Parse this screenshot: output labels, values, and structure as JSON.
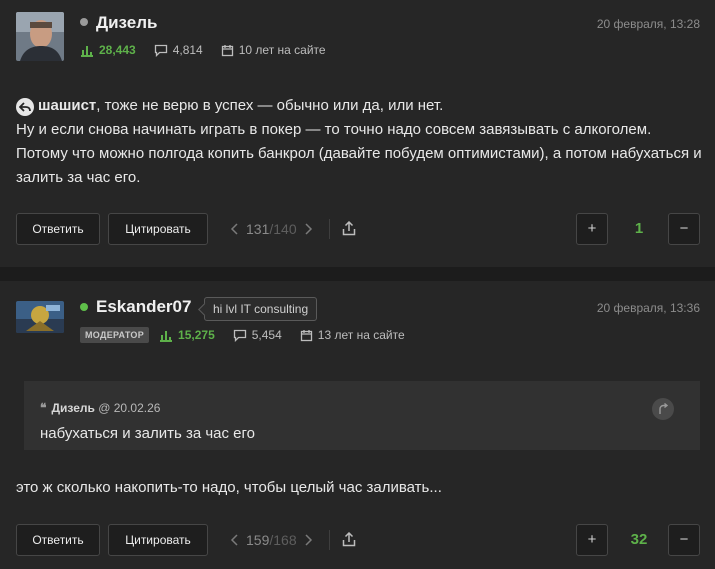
{
  "colors": {
    "rating": "#5eb14a",
    "online": "#5fbf4a",
    "offline": "#9a9a9a",
    "background": "#262626"
  },
  "posts": [
    {
      "author": "Дизель",
      "date": "20 февраля, 13:28",
      "rating": "28,443",
      "comments": "4,814",
      "tenure": "10 лет на сайте",
      "online": false,
      "reply_to": "шашист",
      "text_line1": ", тоже не верю в успех — обычно или да, или нет.",
      "text_line2": "Ну и если снова начинать играть в покер — то точно надо совсем завязывать с алкоголем. Потому что можно полгода копить банкрол (давайте побудем оптимистами), а потом набухаться и залить за час его.",
      "actions": {
        "reply": "Ответить",
        "quote": "Цитировать"
      },
      "pager": {
        "current": "131",
        "total": "140"
      },
      "votes": "1"
    },
    {
      "author": "Eskander07",
      "date": "20 февраля, 13:36",
      "status_tooltip": "hi lvl IT consulting",
      "badge": "МОДЕРАТОР",
      "rating": "15,275",
      "comments": "5,454",
      "tenure": "13 лет на сайте",
      "online": true,
      "quote": {
        "author": "Дизель",
        "date": "@ 20.02.26",
        "text": "набухаться и залить за час его"
      },
      "text": "это ж сколько накопить-то надо, чтобы целый час заливать...",
      "actions": {
        "reply": "Ответить",
        "quote": "Цитировать"
      },
      "pager": {
        "current": "159",
        "total": "168"
      },
      "votes": "32"
    }
  ],
  "icons": {
    "rating": "bar-chart-icon",
    "comments": "speech-bubble-icon",
    "tenure": "calendar-icon",
    "share": "share-icon",
    "reply": "reply-arrow-icon",
    "quote": "quote-icon",
    "jump": "jump-to-quote-icon"
  }
}
